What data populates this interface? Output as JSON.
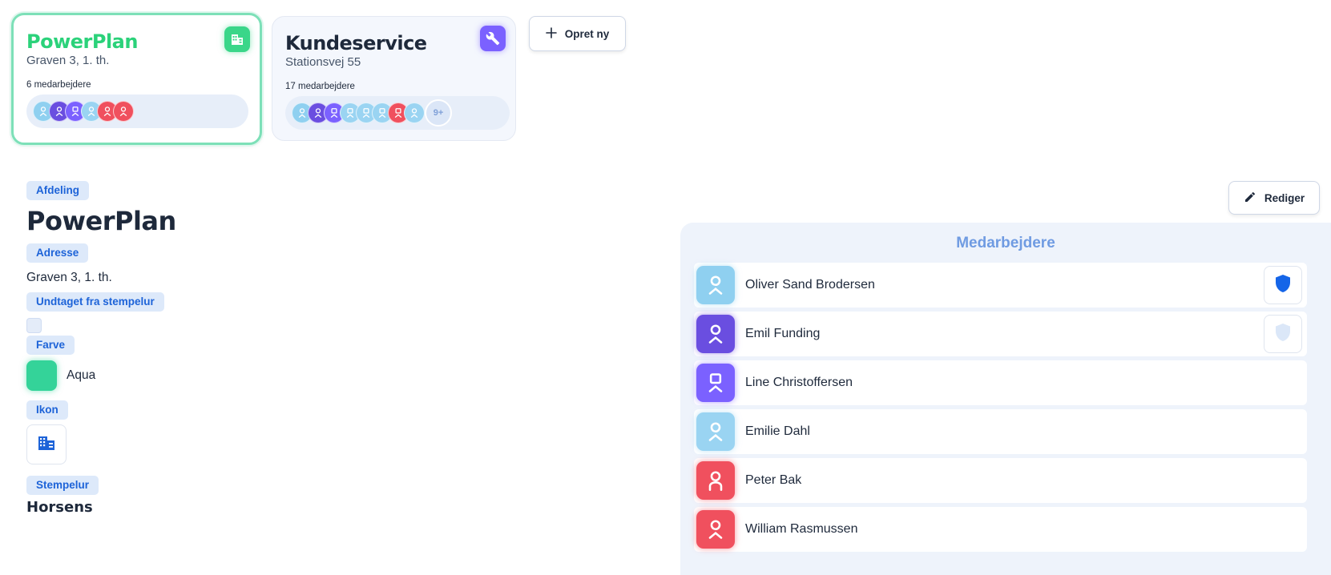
{
  "departments": [
    {
      "name": "PowerPlan",
      "address": "Graven 3, 1. th.",
      "employee_count": "6 medarbejdere",
      "icon": "building-icon",
      "color": "#3ad689",
      "selected": true,
      "avatars": [
        {
          "icon": "person-icon",
          "color": "#8fd0f0"
        },
        {
          "icon": "person-icon",
          "color": "#6a4ee0"
        },
        {
          "icon": "person-square-icon",
          "color": "#7b61ff"
        },
        {
          "icon": "person-icon",
          "color": "#9ad4f2"
        },
        {
          "icon": "person-icon",
          "color": "#f0505e"
        },
        {
          "icon": "person-icon",
          "color": "#f0505e"
        }
      ]
    },
    {
      "name": "Kundeservice",
      "address": "Stationsvej 55",
      "employee_count": "17 medarbejdere",
      "icon": "wrench-icon",
      "color": "#7b61ff",
      "selected": false,
      "avatars": [
        {
          "icon": "person-icon",
          "color": "#8fd0f0"
        },
        {
          "icon": "person-icon",
          "color": "#6a4ee0"
        },
        {
          "icon": "person-square-icon",
          "color": "#7b61ff"
        },
        {
          "icon": "person-square-icon",
          "color": "#9ad4f2"
        },
        {
          "icon": "person-square-icon",
          "color": "#9ad4f2"
        },
        {
          "icon": "person-square-icon",
          "color": "#9ad4f2"
        },
        {
          "icon": "person-square-icon",
          "color": "#f0505e"
        },
        {
          "icon": "person-icon",
          "color": "#9ad4f2"
        }
      ],
      "more": "9+"
    }
  ],
  "create_button": {
    "label": "Opret ny",
    "icon": "plus-icon"
  },
  "details": {
    "section_label": "Afdeling",
    "name": "PowerPlan",
    "address_label": "Adresse",
    "address": "Graven 3, 1. th.",
    "exempt_label": "Undtaget fra stempelur",
    "exempt_checked": false,
    "color_label": "Farve",
    "color_name": "Aqua",
    "color_value": "#34d399",
    "icon_label": "Ikon",
    "icon": "building-icon",
    "clock_label": "Stempelur",
    "clock_value": "Horsens"
  },
  "edit_button": {
    "label": "Rediger",
    "icon": "pencil-icon"
  },
  "employees": {
    "title": "Medarbejdere",
    "items": [
      {
        "name": "Oliver Sand Brodersen",
        "avatar_color": "#8fd0f0",
        "avatar_icon": "person-icon",
        "admin": true
      },
      {
        "name": "Emil Funding",
        "avatar_color": "#6a4ee0",
        "avatar_icon": "person-icon",
        "admin": false
      },
      {
        "name": "Line Christoffersen",
        "avatar_color": "#7b61ff",
        "avatar_icon": "person-square-icon"
      },
      {
        "name": "Emilie Dahl",
        "avatar_color": "#9ad4f2",
        "avatar_icon": "person-icon"
      },
      {
        "name": "Peter Bak",
        "avatar_color": "#f0505e",
        "avatar_icon": "person-arch-icon"
      },
      {
        "name": "William Rasmussen",
        "avatar_color": "#f0505e",
        "avatar_icon": "person-icon"
      }
    ]
  }
}
